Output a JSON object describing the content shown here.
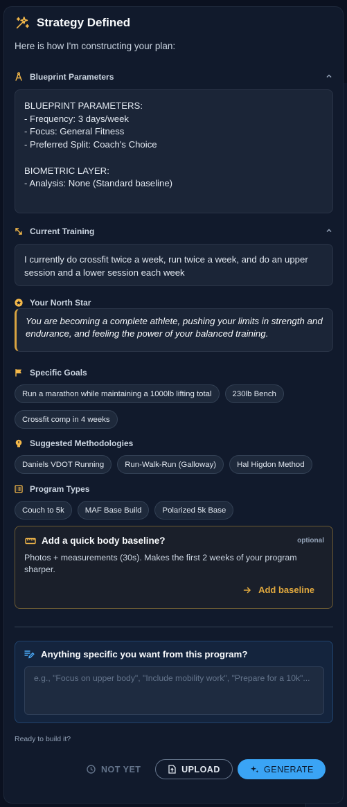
{
  "header": {
    "title": "Strategy Defined",
    "icon": "sparkles-icon"
  },
  "intro": "Here is how I'm constructing your plan:",
  "blueprint": {
    "label": "Blueprint Parameters",
    "lines": [
      "BLUEPRINT PARAMETERS:",
      "- Frequency: 3 days/week",
      "- Focus: General Fitness",
      "- Preferred Split: Coach's Choice",
      "",
      "BIOMETRIC LAYER:",
      "- Analysis: None (Standard baseline)"
    ]
  },
  "current": {
    "label": "Current Training",
    "text": "I currently do crossfit twice a week, run twice a week, and do an upper session and a lower session each week"
  },
  "northstar": {
    "label": "Your North Star",
    "text": "You are becoming a complete athlete, pushing your limits in strength and endurance, and feeling the power of your balanced training."
  },
  "goals": {
    "label": "Specific Goals",
    "items": [
      "Run a marathon while maintaining a 1000lb lifting total",
      "230lb Bench",
      "Crossfit comp in 4 weeks"
    ]
  },
  "methods": {
    "label": "Suggested Methodologies",
    "items": [
      "Daniels VDOT Running",
      "Run-Walk-Run (Galloway)",
      "Hal Higdon Method"
    ]
  },
  "programs": {
    "label": "Program Types",
    "items": [
      "Couch to 5k",
      "MAF Base Build",
      "Polarized 5k Base"
    ]
  },
  "baseline": {
    "title": "Add a quick body baseline?",
    "optional": "optional",
    "desc": "Photos + measurements (30s). Makes the first 2 weeks of your program sharper.",
    "button": "Add baseline"
  },
  "specific": {
    "title": "Anything specific you want from this program?",
    "placeholder": "e.g., \"Focus on upper body\", \"Include mobility work\", \"Prepare for a 10k\"...",
    "value": ""
  },
  "ready": "Ready to build it?",
  "actions": {
    "not_yet": "NOT YET",
    "upload": "UPLOAD",
    "generate": "GENERATE"
  },
  "colors": {
    "accent_gold": "#e0a83e",
    "accent_blue": "#3aa4f5",
    "panel": "#111a2c"
  }
}
